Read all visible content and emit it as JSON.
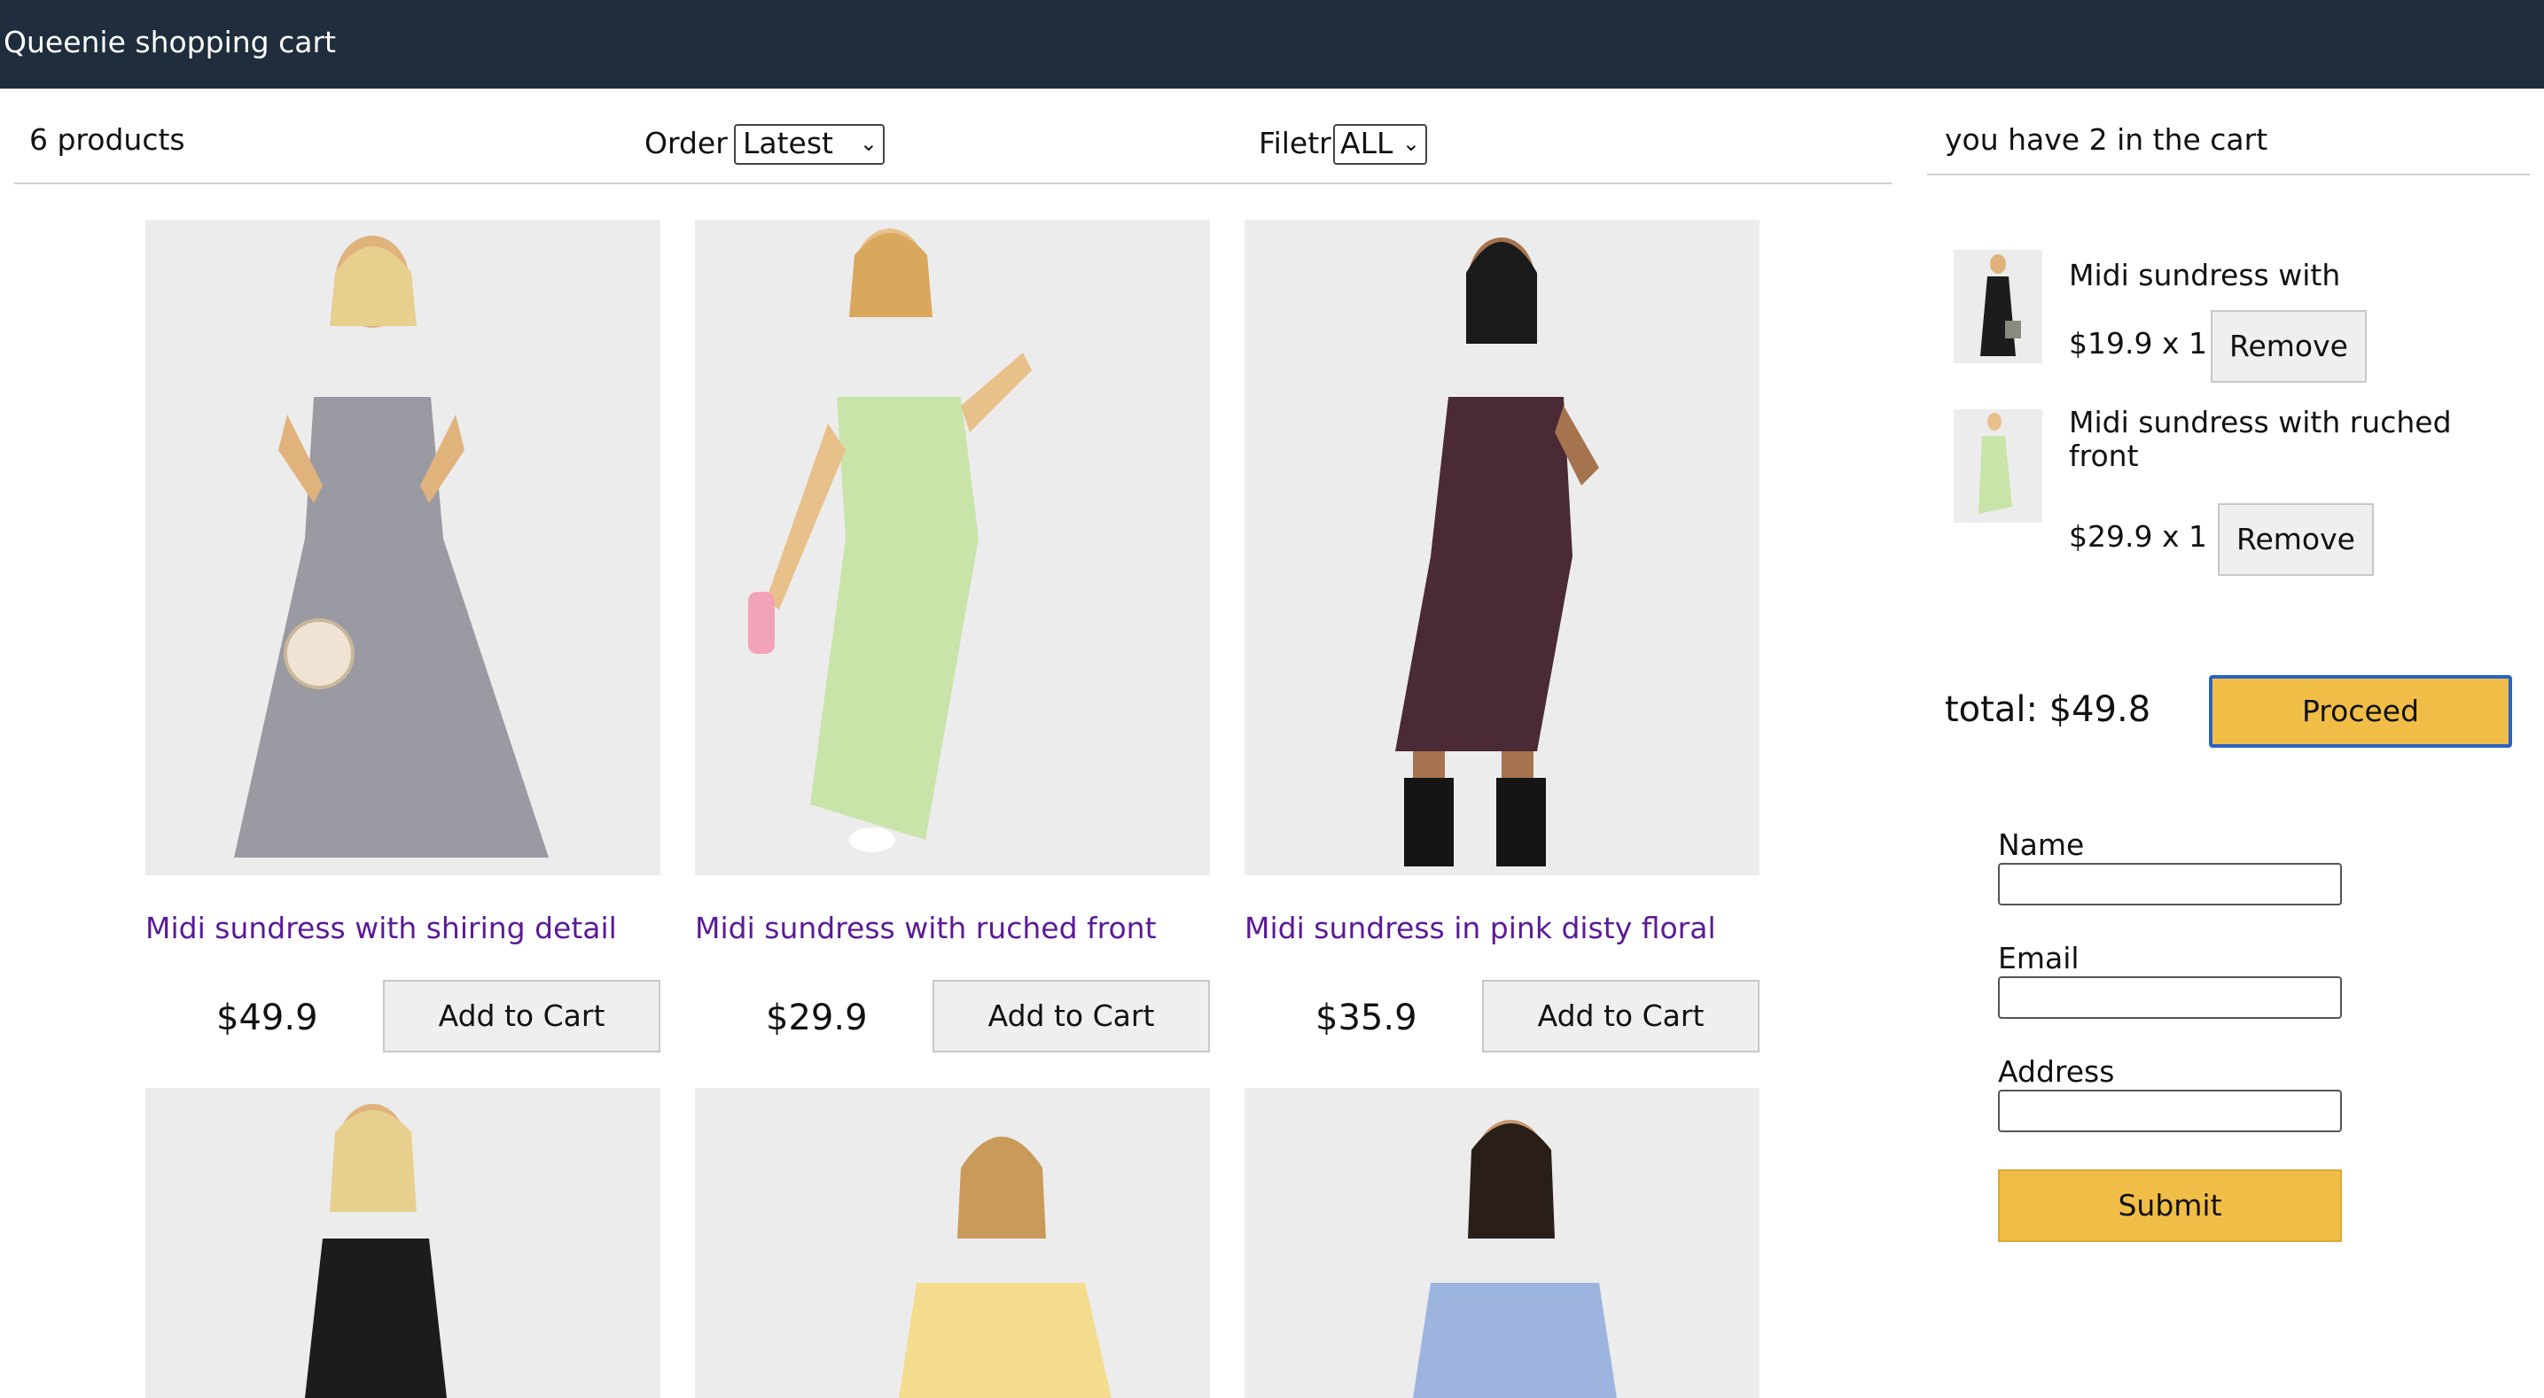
{
  "header": {
    "title": "Queenie shopping cart"
  },
  "toolbar": {
    "product_count": "6 products",
    "order_label": "Order",
    "order_selected": "Latest",
    "filter_label": "Filetr",
    "filter_selected": "ALL"
  },
  "products": [
    {
      "name": "Midi sundress with shiring detail",
      "price": "$49.9",
      "button": "Add to Cart",
      "dress_color": "#9a9aa3",
      "pattern_color": "#5a4a6a"
    },
    {
      "name": "Midi sundress with ruched front",
      "price": "$29.9",
      "button": "Add to Cart",
      "dress_color": "#c9e4a8",
      "pattern_color": "#6aa056"
    },
    {
      "name": "Midi sundress in pink disty floral",
      "price": "$35.9",
      "button": "Add to Cart",
      "dress_color": "#4a2a34",
      "pattern_color": "#d86a80"
    },
    {
      "dress_color": "#1c1c1c",
      "pattern_color": "#ffffff"
    },
    {
      "dress_color": "#f4dc8e",
      "pattern_color": "#e8c870"
    },
    {
      "dress_color": "#9db4de",
      "pattern_color": "#d05a6a"
    }
  ],
  "cart": {
    "summary": "you have 2 in the cart",
    "items": [
      {
        "name": "Midi sundress with",
        "price_qty": "$19.9 x 1",
        "remove": "Remove",
        "dress_color": "#1c1c1c"
      },
      {
        "name": "Midi sundress with ruched front",
        "price_qty": "$29.9 x 1",
        "remove": "Remove",
        "dress_color": "#c9e4a8"
      }
    ],
    "total": "total: $49.8",
    "proceed": "Proceed"
  },
  "form": {
    "name_label": "Name",
    "email_label": "Email",
    "address_label": "Address",
    "submit": "Submit"
  },
  "colors": {
    "header_bg": "#1f2d3d",
    "link_purple": "#5b1a97",
    "accent_yellow": "#f0be47",
    "focus_blue": "#2a62c4"
  }
}
